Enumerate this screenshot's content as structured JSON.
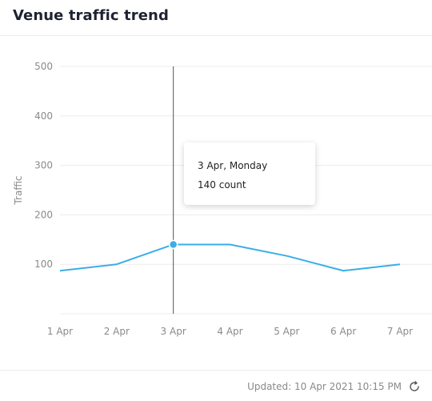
{
  "card": {
    "title": "Venue traffic trend"
  },
  "tooltip": {
    "date": "3 Apr, Monday",
    "value_text": "140 count"
  },
  "footer": {
    "updated": "Updated: 10 Apr 2021 10:15 PM",
    "refresh_icon": "refresh-icon"
  },
  "colors": {
    "line": "#3aaee8",
    "grid": "#ececec",
    "crosshair": "#555555",
    "tick": "#8a8a8a"
  },
  "chart_data": {
    "type": "line",
    "title": "Venue traffic trend",
    "ylabel": "Traffic",
    "xlabel": "",
    "categories": [
      "1 Apr",
      "2 Apr",
      "3 Apr",
      "4 Apr",
      "5 Apr",
      "6 Apr",
      "7 Apr"
    ],
    "series": [
      {
        "values": [
          87,
          100,
          140,
          140,
          117,
          87,
          100
        ]
      }
    ],
    "ylim": [
      0,
      500
    ],
    "yticks": [
      100,
      200,
      300,
      400,
      500
    ],
    "highlight_index": 2,
    "grid": true
  }
}
